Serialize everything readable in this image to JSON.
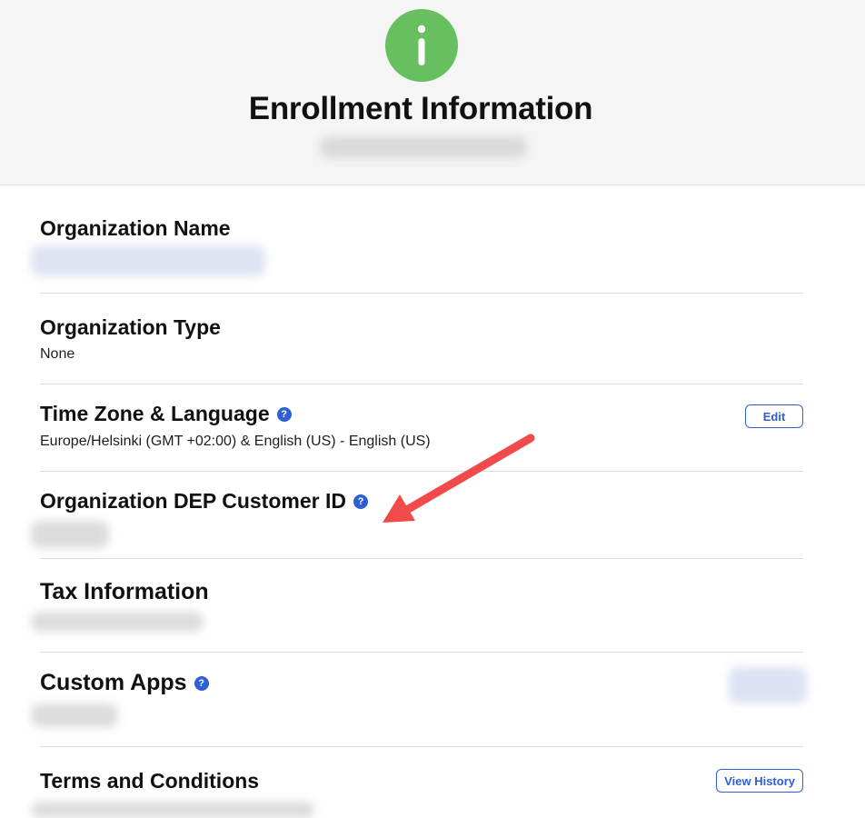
{
  "header": {
    "title": "Enrollment Information",
    "icon": "info-icon",
    "icon_color": "#67bf5f"
  },
  "sections": [
    {
      "title": "Organization Name",
      "value": ""
    },
    {
      "title": "Organization Type",
      "value": "None"
    },
    {
      "title": "Time Zone & Language",
      "value": "Europe/Helsinki (GMT +02:00) & English (US) - English (US)",
      "help": "?",
      "button": "Edit"
    },
    {
      "title": "Organization DEP Customer ID",
      "value": "",
      "help": "?"
    },
    {
      "title": "Tax Information",
      "value": ""
    },
    {
      "title": "Custom Apps",
      "value": "",
      "help": "?"
    },
    {
      "title": "Terms and Conditions",
      "value": "",
      "button": "View History"
    }
  ],
  "colors": {
    "accent": "#2f5fd6",
    "annotation_arrow": "#f04a4a"
  }
}
